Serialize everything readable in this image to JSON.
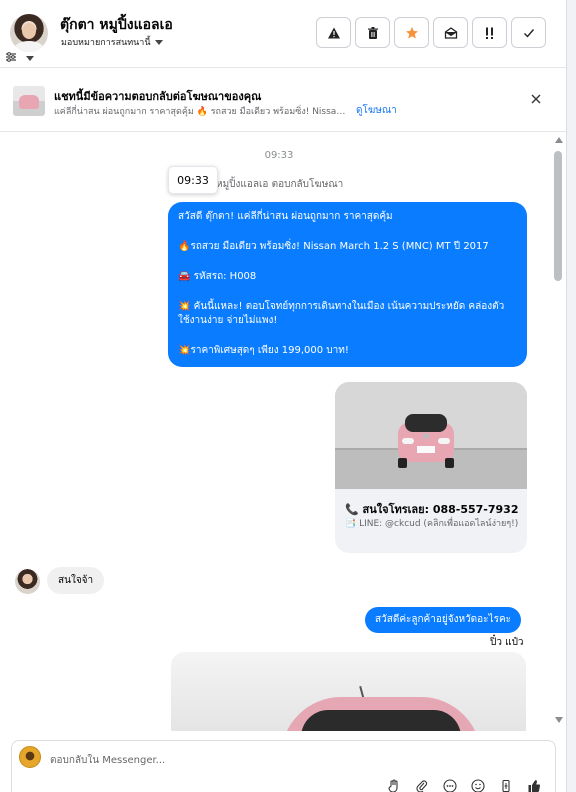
{
  "header": {
    "contact_name": "ตุ๊กตา หมูปิ้งแอลเอ",
    "assign_label": "มอบหมายการสนทนานี้",
    "toolbar": {
      "spam": "warning-icon",
      "delete": "trash-icon",
      "star": "star-icon",
      "mark_unread": "envelope-open-icon",
      "follow_up": "flag-icon",
      "done": "check-icon"
    }
  },
  "ad_banner": {
    "title": "แชทนี้มีข้อความตอบกลับต่อโฆษณาของคุณ",
    "snippet": "แค่ลีกี่น่าสน ผ่อนถูกมาก ราคาสุดคุ้ม 🔥 รถสวย มือเดียว พร้อมซิ่ง! Nissan ...",
    "view_ad": "ดูโฆษณา"
  },
  "chat": {
    "timestamp": "09:33",
    "tooltip_time": "09:33",
    "reply_note": "หมูปิ้งแอลเอ ตอบกลับโฆษณา",
    "ad_message_lines": [
      "สวัสดี ตุ๊กตา! แค่ลีกี่น่าสน ผ่อนถูกมาก ราคาสุดคุ้ม",
      "🔥รถสวย มือเดียว พร้อมซิ่ง! Nissan March 1.2 S (MNC) MT ปี 2017",
      "🚘 รหัสรถ: H008",
      "💥 คันนี้แหละ! ตอบโจทย์ทุกการเดินทางในเมือง เน้นความประหยัด คล่องตัว ใช้งานง่าย จ่ายไม่แพง!",
      "💥ราคาพิเศษสุดๆ เพียง 199,000 บาท!"
    ],
    "card": {
      "phone": "📞 สนใจโทรเลย: 088-557-7932",
      "line": "📑 LINE: @ckcud (คลิกเพื่อแอดไลน์ง่ายๆ!)"
    },
    "incoming_message": "สนใจจ้า",
    "outgoing_question": "สวัสดีค่ะลูกค้าอยู่จังหวัดอะไรคะ",
    "sender_name": "ปิ๋ว แป๋ว"
  },
  "composer": {
    "placeholder": "ตอบกลับใน Messenger...",
    "icons": [
      "hand-icon",
      "paperclip-icon",
      "more-icon",
      "emoji-icon",
      "tag-icon",
      "like-icon"
    ]
  },
  "colors": {
    "accent": "#0a7cff",
    "star": "#f7923a",
    "link": "#1877f2"
  }
}
